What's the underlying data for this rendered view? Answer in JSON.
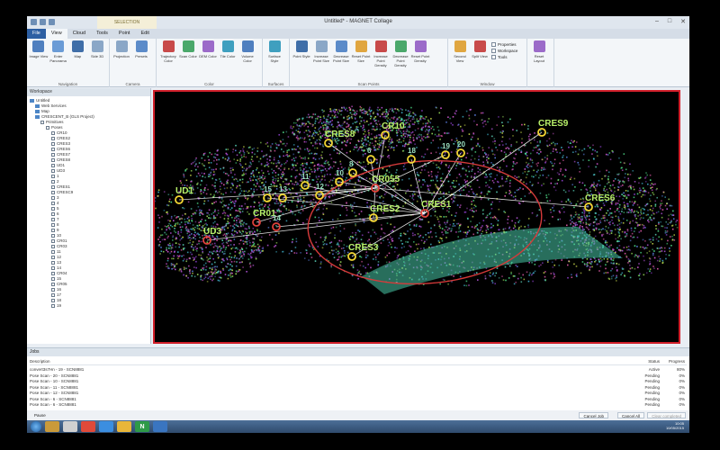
{
  "window": {
    "title": "Untitled* - MAGNET Collage",
    "context_tab": "SELECTION"
  },
  "tabs": [
    "File",
    "View",
    "Cloud",
    "Tools",
    "Point",
    "Edit"
  ],
  "active_tab": "View",
  "ribbon": {
    "groups": [
      {
        "label": "Navigation",
        "buttons": [
          "Image View",
          "Enter Panorama",
          "Map",
          "Side 3D"
        ]
      },
      {
        "label": "Camera",
        "buttons": [
          "Projection",
          "Presets"
        ]
      },
      {
        "label": "Color",
        "buttons": [
          "Trajectory Color",
          "Scan Color",
          "DEM Color",
          "Tile Color",
          "Volume Color"
        ]
      },
      {
        "label": "Surfaces",
        "buttons": [
          "Surface Style"
        ]
      },
      {
        "label": "Scan Points",
        "buttons": [
          "Point Style",
          "Increase Point Size",
          "Decrease Point Size",
          "Reset Point Size",
          "Increase Point Density",
          "Decrease Point Density",
          "Reset Point Density"
        ]
      },
      {
        "label": "Window",
        "buttons": [
          "Second View",
          "Split View"
        ],
        "checks": [
          "Properties",
          "Workspace",
          "Tools"
        ]
      },
      {
        "label": "",
        "buttons": [
          "Reset Layout"
        ]
      }
    ]
  },
  "workspace": {
    "title": "Workspace",
    "items": [
      {
        "label": "Untitled",
        "kind": "folder",
        "indent": 0
      },
      {
        "label": "Web Services",
        "kind": "item",
        "indent": 1
      },
      {
        "label": "Map",
        "kind": "item",
        "indent": 1
      },
      {
        "label": "CRESCENT_B (GLS Project)",
        "kind": "folder",
        "indent": 1
      },
      {
        "label": "Primitives",
        "kind": "check",
        "indent": 2
      },
      {
        "label": "Poses",
        "kind": "check",
        "indent": 3
      },
      {
        "label": "CR10",
        "kind": "check",
        "indent": 4
      },
      {
        "label": "CRES2",
        "kind": "check",
        "indent": 4
      },
      {
        "label": "CRES3",
        "kind": "check",
        "indent": 4
      },
      {
        "label": "CRES6",
        "kind": "check",
        "indent": 4
      },
      {
        "label": "CRES7",
        "kind": "check",
        "indent": 4
      },
      {
        "label": "CRES8",
        "kind": "check",
        "indent": 4
      },
      {
        "label": "UD1",
        "kind": "check",
        "indent": 4
      },
      {
        "label": "UD3",
        "kind": "check",
        "indent": 4
      },
      {
        "label": "1",
        "kind": "check",
        "indent": 4
      },
      {
        "label": "2",
        "kind": "check",
        "indent": 4
      },
      {
        "label": "CRES1",
        "kind": "check",
        "indent": 4
      },
      {
        "label": "CRESC9",
        "kind": "check",
        "indent": 4
      },
      {
        "label": "3",
        "kind": "check",
        "indent": 4
      },
      {
        "label": "4",
        "kind": "check",
        "indent": 4
      },
      {
        "label": "5",
        "kind": "check",
        "indent": 4
      },
      {
        "label": "6",
        "kind": "check",
        "indent": 4
      },
      {
        "label": "7",
        "kind": "check",
        "indent": 4
      },
      {
        "label": "8",
        "kind": "check",
        "indent": 4
      },
      {
        "label": "9",
        "kind": "check",
        "indent": 4
      },
      {
        "label": "10",
        "kind": "check",
        "indent": 4
      },
      {
        "label": "CR01",
        "kind": "check",
        "indent": 4
      },
      {
        "label": "CR03",
        "kind": "check",
        "indent": 4
      },
      {
        "label": "11",
        "kind": "check",
        "indent": 4
      },
      {
        "label": "12",
        "kind": "check",
        "indent": 4
      },
      {
        "label": "13",
        "kind": "check",
        "indent": 4
      },
      {
        "label": "14",
        "kind": "check",
        "indent": 4
      },
      {
        "label": "CR04",
        "kind": "check",
        "indent": 4
      },
      {
        "label": "15",
        "kind": "check",
        "indent": 4
      },
      {
        "label": "CR05",
        "kind": "check",
        "indent": 4
      },
      {
        "label": "16",
        "kind": "check",
        "indent": 4
      },
      {
        "label": "17",
        "kind": "check",
        "indent": 4
      },
      {
        "label": "18",
        "kind": "check",
        "indent": 4
      },
      {
        "label": "19",
        "kind": "check",
        "indent": 4
      }
    ]
  },
  "viewport": {
    "stations": [
      {
        "label": "UD1",
        "color": "#f3d633"
      },
      {
        "label": "UD3",
        "color": "#e0413b"
      },
      {
        "label": "CR01",
        "color": "#e0413b"
      },
      {
        "label": "CRES8",
        "color": "#f3d633"
      },
      {
        "label": "CR10",
        "color": "#f3d633"
      },
      {
        "label": "CRES9",
        "color": "#f3d633"
      },
      {
        "label": "CRES6",
        "color": "#f3d633"
      },
      {
        "label": "CRES1",
        "color": "#e0413b"
      },
      {
        "label": "CRES2",
        "color": "#f3d633"
      },
      {
        "label": "CRES3",
        "color": "#f3d633"
      },
      {
        "label": "CR055",
        "color": "#e0413b"
      },
      {
        "label": "15",
        "color": "#f3d633"
      },
      {
        "label": "13",
        "color": "#f3d633"
      },
      {
        "label": "11",
        "color": "#f3d633"
      },
      {
        "label": "12",
        "color": "#f3d633"
      },
      {
        "label": "14",
        "color": "#e0413b"
      },
      {
        "label": "10",
        "color": "#f3d633"
      },
      {
        "label": "8",
        "color": "#f3d633"
      },
      {
        "label": "6",
        "color": "#f3d633"
      },
      {
        "label": "18",
        "color": "#f3d633"
      },
      {
        "label": "19",
        "color": "#f3d633"
      },
      {
        "label": "20",
        "color": "#f3d633"
      }
    ]
  },
  "jobs": {
    "title": "Jobs",
    "columns": [
      "Description",
      "Status",
      "Progress"
    ],
    "rows": [
      {
        "description": "convert3s7Hn - 19 - SCN8881",
        "status": "Active",
        "progress": "80%"
      },
      {
        "description": "Pose Scan - 20 - SCN8881",
        "status": "Pending",
        "progress": "0%"
      },
      {
        "description": "Pose Scan - 10 - SCN8881",
        "status": "Pending",
        "progress": "0%"
      },
      {
        "description": "Pose Scan - 11 - SCN8881",
        "status": "Pending",
        "progress": "0%"
      },
      {
        "description": "Pose Scan - 12 - SCN8881",
        "status": "Pending",
        "progress": "0%"
      },
      {
        "description": "Pose Scan - 6 - SCN8881",
        "status": "Pending",
        "progress": "0%"
      },
      {
        "description": "Pose Scan - 6 - SCN8881",
        "status": "Pending",
        "progress": "0%"
      }
    ],
    "pause_label": "Pause",
    "cancel_job": "Cancel Job",
    "cancel_all": "Cancel All",
    "clear_completed": "Clear completed"
  },
  "taskbar": {
    "apps": [
      "explorer",
      "media",
      "chrome",
      "ie",
      "files",
      "N",
      "collage"
    ],
    "app_colors": [
      "#c99a3a",
      "#d0d0d0",
      "#e04a3a",
      "#3b8ee0",
      "#e8b63a",
      "#2e9a47",
      "#3a75c0"
    ],
    "time": "10:05",
    "date": "10/05/2015"
  }
}
